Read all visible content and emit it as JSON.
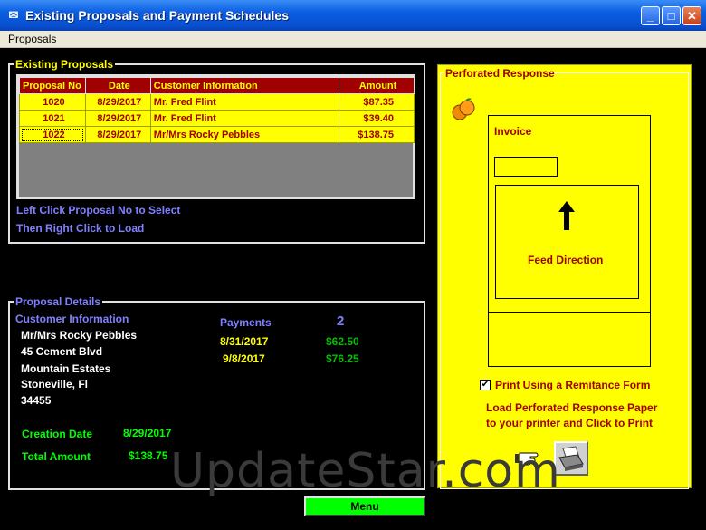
{
  "window": {
    "title": "Existing Proposals and Payment Schedules"
  },
  "menu": {
    "proposals": "Proposals"
  },
  "existing": {
    "legend": "Existing Proposals",
    "columns": [
      "Proposal No",
      "Date",
      "Customer Information",
      "Amount"
    ],
    "rows": [
      [
        "1020",
        "8/29/2017",
        "Mr. Fred   Flint",
        "$87.35"
      ],
      [
        "1021",
        "8/29/2017",
        "Mr. Fred   Flint",
        "$39.40"
      ],
      [
        "1022",
        "8/29/2017",
        "Mr/Mrs Rocky   Pebbles",
        "$138.75"
      ]
    ],
    "hint1": "Left Click Proposal No to Select",
    "hint2": "Then Right Click to Load"
  },
  "details": {
    "legend": "Proposal Details",
    "customer_label": "Customer Information",
    "name": "Mr/Mrs Rocky   Pebbles",
    "address1": "45 Cement Blvd",
    "address2": "Mountain Estates",
    "city": "Stoneville, Fl",
    "zip": "34455",
    "payments_label": "Payments",
    "payments_count": "2",
    "payments": [
      {
        "date": "8/31/2017",
        "amount": "$62.50"
      },
      {
        "date": "9/8/2017",
        "amount": "$76.25"
      }
    ],
    "creation_label": "Creation Date",
    "creation_value": "8/29/2017",
    "total_label": "Total Amount",
    "total_value": "$138.75"
  },
  "perforated": {
    "title": "Perforated Response",
    "invoice": "Invoice",
    "feed": "Feed Direction",
    "print_checkbox": "Print Using a Remitance Form",
    "instr1": "Load Perforated Response Paper",
    "instr2": "to your printer and Click to Print"
  },
  "menu_button": "Menu",
  "watermark": "UpdateStar.com",
  "colors": {
    "panel": "#ffff00",
    "header": "#a00000",
    "menu_button": "#00ff00"
  }
}
